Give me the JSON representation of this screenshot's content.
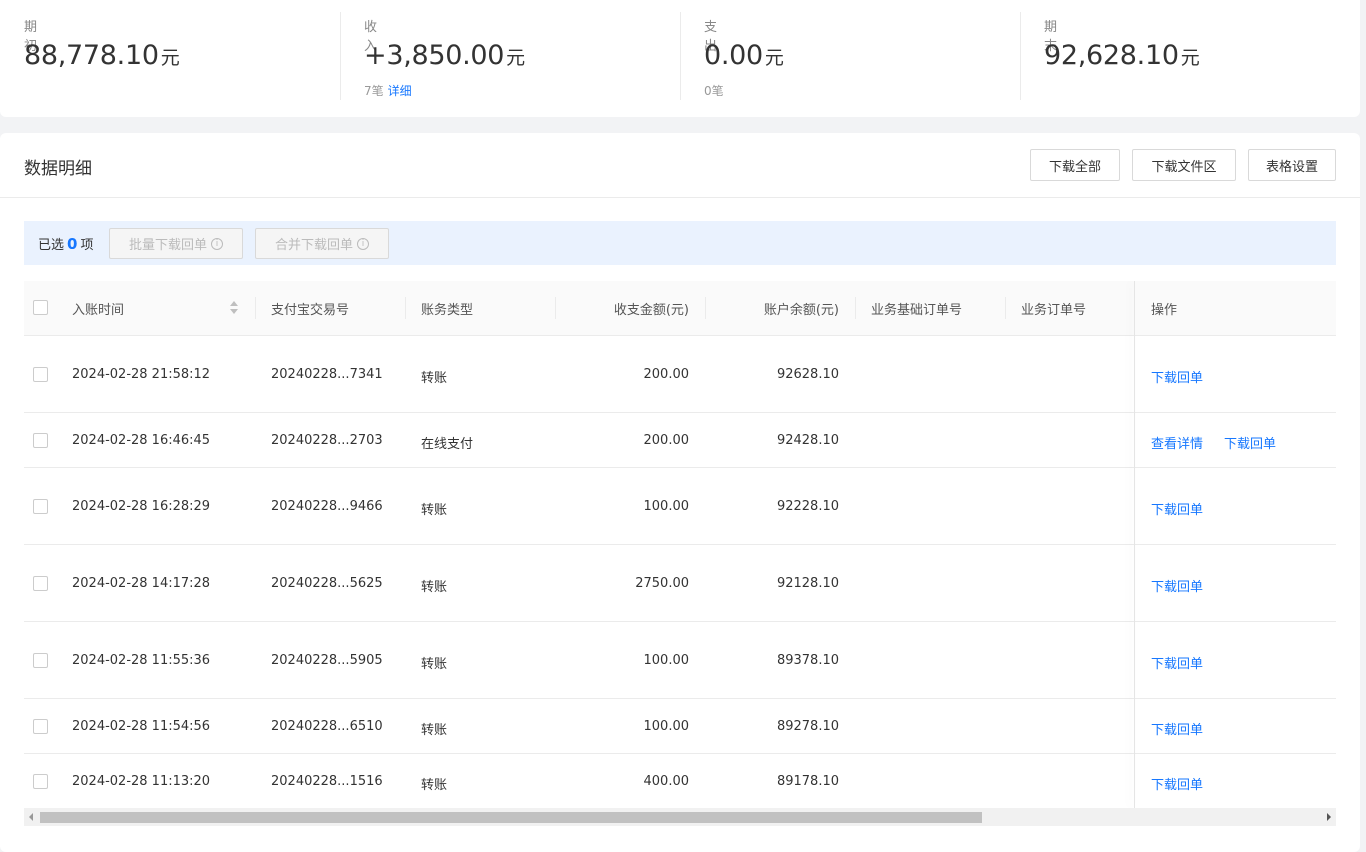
{
  "summary": {
    "opening": {
      "label": "期初",
      "amount": "88,778.10",
      "unit": "元"
    },
    "income": {
      "label": "收入",
      "amount": "+3,850.00",
      "unit": "元",
      "count": "7笔",
      "detail_link": "详细"
    },
    "expense": {
      "label": "支出",
      "amount": "0.00",
      "unit": "元",
      "count": "0笔"
    },
    "closing": {
      "label": "期末",
      "amount": "92,628.10",
      "unit": "元"
    }
  },
  "panel": {
    "title": "数据明细",
    "buttons": {
      "download_all": "下载全部",
      "download_area": "下载文件区",
      "table_settings": "表格设置"
    }
  },
  "selection": {
    "prefix": "已选",
    "count": "0",
    "suffix": "项",
    "batch_download": "批量下载回单",
    "merge_download": "合并下载回单"
  },
  "table": {
    "columns": {
      "time": "入账时间",
      "trade_no": "支付宝交易号",
      "type": "账务类型",
      "amount": "收支金额(元)",
      "balance": "账户余额(元)",
      "base_order": "业务基础订单号",
      "order": "业务订单号",
      "ops": "操作"
    },
    "rows": [
      {
        "time": "2024-02-28 21:58:12",
        "trade_no": "20240228...7341",
        "type": "转账",
        "amount": "200.00",
        "balance": "92628.10",
        "action1": "下载回单",
        "action2": ""
      },
      {
        "time": "2024-02-28 16:46:45",
        "trade_no": "20240228...2703",
        "type": "在线支付",
        "amount": "200.00",
        "balance": "92428.10",
        "action1": "查看详情",
        "action2": "下载回单"
      },
      {
        "time": "2024-02-28 16:28:29",
        "trade_no": "20240228...9466",
        "type": "转账",
        "amount": "100.00",
        "balance": "92228.10",
        "action1": "下载回单",
        "action2": ""
      },
      {
        "time": "2024-02-28 14:17:28",
        "trade_no": "20240228...5625",
        "type": "转账",
        "amount": "2750.00",
        "balance": "92128.10",
        "action1": "下载回单",
        "action2": ""
      },
      {
        "time": "2024-02-28 11:55:36",
        "trade_no": "20240228...5905",
        "type": "转账",
        "amount": "100.00",
        "balance": "89378.10",
        "action1": "下载回单",
        "action2": ""
      },
      {
        "time": "2024-02-28 11:54:56",
        "trade_no": "20240228...6510",
        "type": "转账",
        "amount": "100.00",
        "balance": "89278.10",
        "action1": "下载回单",
        "action2": ""
      },
      {
        "time": "2024-02-28 11:13:20",
        "trade_no": "20240228...1516",
        "type": "转账",
        "amount": "400.00",
        "balance": "89178.10",
        "action1": "下载回单",
        "action2": ""
      }
    ]
  }
}
